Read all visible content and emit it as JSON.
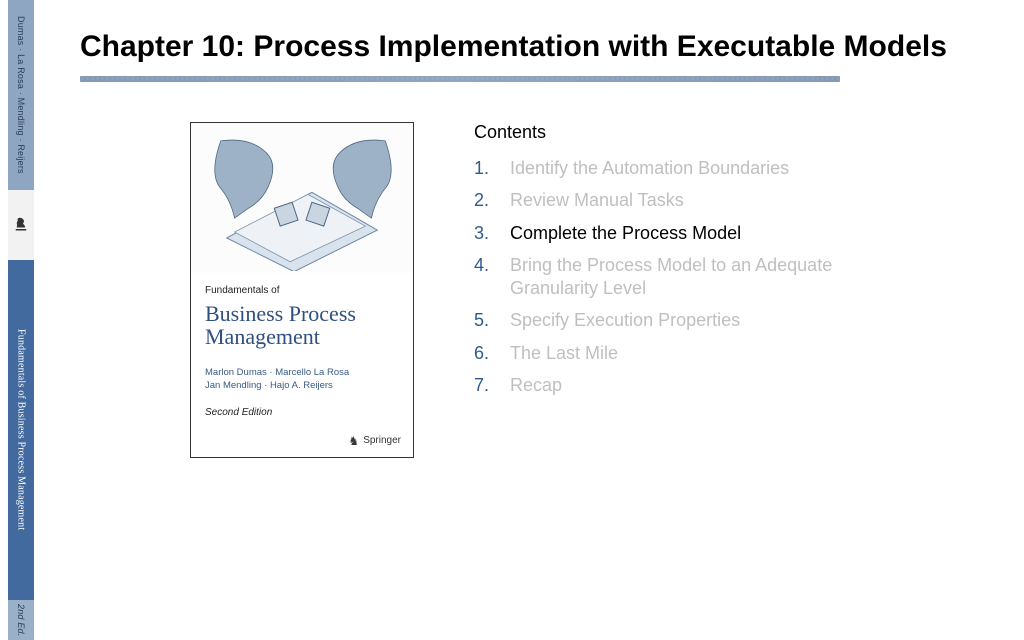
{
  "spine": {
    "authors": "Dumas · La Rosa · Mendling · Reijers",
    "title": "Fundamentals of Business Process Management",
    "edition": "2nd Ed."
  },
  "slide": {
    "title": "Chapter 10: Process Implementation with Executable Models"
  },
  "cover": {
    "overline": "Fundamentals of",
    "title_html": "Business Process\nManagement",
    "authors_line1": "Marlon Dumas · Marcello La Rosa",
    "authors_line2": "Jan Mendling · Hajo A. Reijers",
    "edition": "Second Edition",
    "publisher": "Springer"
  },
  "contents": {
    "heading": "Contents",
    "active_index": 2,
    "items": [
      {
        "num": "1.",
        "label": "Identify the Automation Boundaries"
      },
      {
        "num": "2.",
        "label": "Review Manual Tasks"
      },
      {
        "num": "3.",
        "label": "Complete the Process Model"
      },
      {
        "num": "4.",
        "label": "Bring the Process Model to an Adequate Granularity Level"
      },
      {
        "num": "5.",
        "label": "Specify Execution Properties"
      },
      {
        "num": "6.",
        "label": "The Last Mile"
      },
      {
        "num": "7.",
        "label": "Recap"
      }
    ]
  }
}
